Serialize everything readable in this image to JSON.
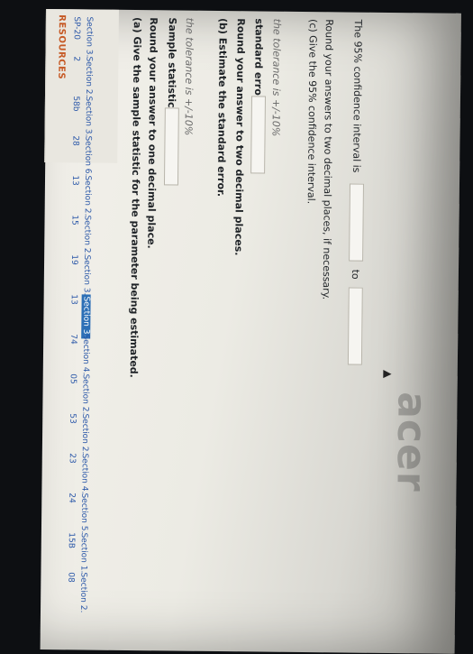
{
  "sidebar": {
    "title": "RESOURCES",
    "items": [
      {
        "label": "SP-20"
      },
      {
        "label": "Section 3."
      },
      {
        "label": "2"
      },
      {
        "label": "Section 2."
      },
      {
        "label": "58b"
      },
      {
        "label": "Section 3."
      },
      {
        "label": "28"
      },
      {
        "label": "Section 6."
      },
      {
        "label": "13"
      },
      {
        "label": "Section 2."
      },
      {
        "label": "15"
      },
      {
        "label": "Section 2."
      },
      {
        "label": "19"
      },
      {
        "label": "Section 3."
      },
      {
        "label": "13"
      },
      {
        "label": "Section 3."
      },
      {
        "label": "74"
      },
      {
        "label": "Section 4."
      },
      {
        "label": "05"
      },
      {
        "label": "Section 2."
      },
      {
        "label": "53"
      },
      {
        "label": "Section 2."
      },
      {
        "label": "23"
      },
      {
        "label": "Section 4."
      },
      {
        "label": "24"
      },
      {
        "label": "Section 5."
      },
      {
        "label": "15B"
      },
      {
        "label": "Section 1."
      },
      {
        "label": "08"
      },
      {
        "label": "Section 2."
      }
    ]
  },
  "part_a": {
    "title": "(a) Give the sample statistic for the parameter being estimated.",
    "instruction": "Round your answer to one decimal place.",
    "label": "Sample statistic=",
    "value": "",
    "tolerance": "the tolerance is +/-10%"
  },
  "part_b": {
    "title": "(b) Estimate the standard error.",
    "instruction": "Round your answer to two decimal places.",
    "label": "standard error=",
    "value": "",
    "tolerance": "the tolerance is +/-10%"
  },
  "part_c": {
    "title": "(c) Give the 95% confidence interval.",
    "instruction": "Round your answers to two decimal places, if necessary.",
    "label": "The 95% confidence interval is",
    "to_label": "to",
    "from_value": "",
    "to_value": ""
  },
  "bezel": {
    "brand": "acer"
  }
}
